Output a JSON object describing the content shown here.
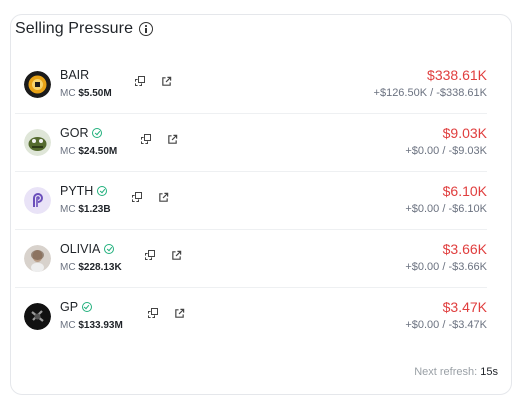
{
  "widget": {
    "title": "Selling Pressure"
  },
  "tokens": [
    {
      "symbol": "BAIR",
      "verified": false,
      "mc_label": "MC",
      "mc_value": "$5.50M",
      "amount": "$338.61K",
      "detail": "+$126.50K / -$338.61K",
      "avatar_color": "#1b1b1b"
    },
    {
      "symbol": "GOR",
      "verified": true,
      "mc_label": "MC",
      "mc_value": "$24.50M",
      "amount": "$9.03K",
      "detail": "+$0.00 / -$9.03K",
      "avatar_color": "#556b2f"
    },
    {
      "symbol": "PYTH",
      "verified": true,
      "mc_label": "MC",
      "mc_value": "$1.23B",
      "amount": "$6.10K",
      "detail": "+$0.00 / -$6.10K",
      "avatar_color": "#e9e3f7"
    },
    {
      "symbol": "OLIVIA",
      "verified": true,
      "mc_label": "MC",
      "mc_value": "$228.13K",
      "amount": "$3.66K",
      "detail": "+$0.00 / -$3.66K",
      "avatar_color": "#c9bfb5"
    },
    {
      "symbol": "GP",
      "verified": true,
      "mc_label": "MC",
      "mc_value": "$133.93M",
      "amount": "$3.47K",
      "detail": "+$0.00 / -$3.47K",
      "avatar_color": "#111111"
    }
  ],
  "footer": {
    "refresh_label": "Next refresh:",
    "refresh_value": "15s"
  },
  "colors": {
    "negative": "#e03e3e",
    "verified": "#22b07d"
  }
}
